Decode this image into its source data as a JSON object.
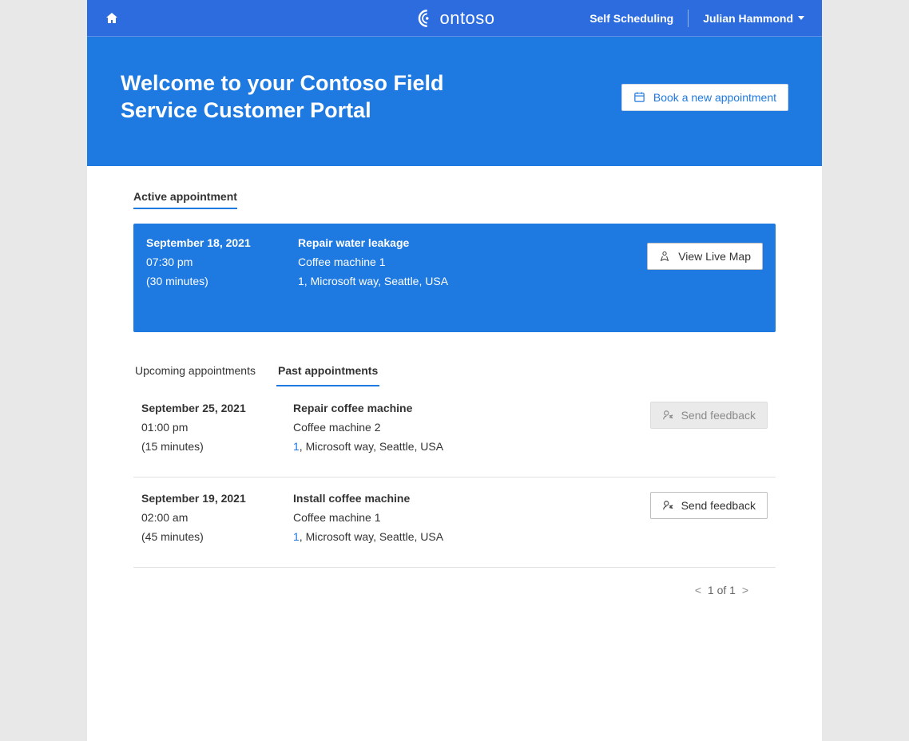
{
  "brand": "ontoso",
  "nav": {
    "self_scheduling": "Self Scheduling",
    "user_name": "Julian Hammond"
  },
  "hero": {
    "title": "Welcome to your Contoso Field Service Customer Portal",
    "book_button": "Book a new appointment"
  },
  "active": {
    "heading": "Active appointment",
    "date": "September 18, 2021",
    "time": "07:30 pm",
    "duration": "(30 minutes)",
    "title": "Repair water leakage",
    "asset": "Coffee machine 1",
    "address": "1, Microsoft way, Seattle, USA",
    "view_map": "View Live Map"
  },
  "tabs": {
    "upcoming": "Upcoming appointments",
    "past": "Past appointments"
  },
  "past": [
    {
      "date": "September 25, 2021",
      "time": "01:00 pm",
      "duration": "(15 minutes)",
      "title": "Repair coffee machine",
      "asset": "Coffee machine 2",
      "address_link": "1",
      "address_rest": ", Microsoft way, Seattle, USA",
      "feedback_label": "Send feedback",
      "feedback_disabled": true
    },
    {
      "date": "September 19, 2021",
      "time": "02:00 am",
      "duration": "(45 minutes)",
      "title": "Install coffee machine",
      "asset": "Coffee machine 1",
      "address_link": "1",
      "address_rest": ", Microsoft way, Seattle, USA",
      "feedback_label": "Send feedback",
      "feedback_disabled": false
    }
  ],
  "pager": {
    "prev": "<",
    "text": "1 of 1",
    "next": ">"
  }
}
